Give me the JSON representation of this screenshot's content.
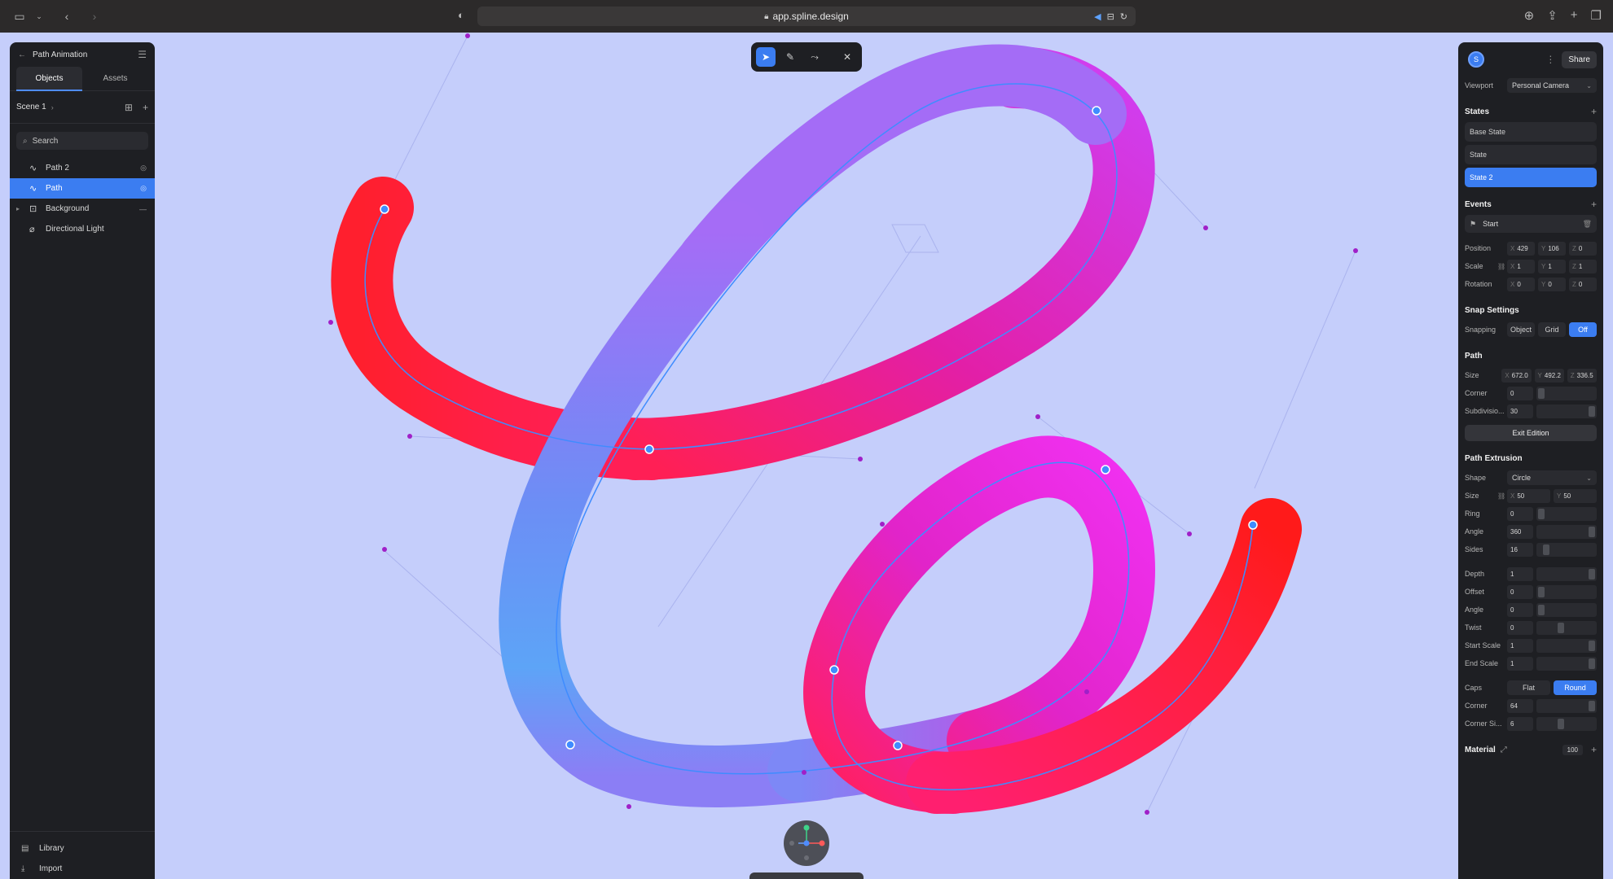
{
  "browser": {
    "url": "app.spline.design"
  },
  "left_panel": {
    "project_title": "Path Animation",
    "tabs": [
      "Objects",
      "Assets"
    ],
    "scene_label": "Scene 1",
    "search_placeholder": "Search",
    "objects": [
      {
        "name": "Path 2",
        "icon": "path-icon",
        "selected": false
      },
      {
        "name": "Path",
        "icon": "path-icon",
        "selected": true
      },
      {
        "name": "Background",
        "icon": "background-icon",
        "selected": false
      },
      {
        "name": "Directional Light",
        "icon": "light-icon",
        "selected": false
      }
    ],
    "footer": [
      "Library",
      "Import"
    ]
  },
  "toolbar": {
    "tools": [
      "select-tool",
      "pen-tool",
      "curve-tool",
      "close"
    ]
  },
  "right_panel": {
    "avatar_letter": "S",
    "share_label": "Share",
    "viewport_label": "Viewport",
    "viewport_value": "Personal Camera",
    "states_title": "States",
    "states": [
      "Base State",
      "State",
      "State 2"
    ],
    "active_state": "State 2",
    "events_title": "Events",
    "event": "Start",
    "position_label": "Position",
    "position": {
      "x": "429",
      "y": "106",
      "z": "0"
    },
    "scale_label": "Scale",
    "scale": {
      "x": "1",
      "y": "1",
      "z": "1"
    },
    "rotation_label": "Rotation",
    "rotation": {
      "x": "0",
      "y": "0",
      "z": "0"
    },
    "snap_title": "Snap Settings",
    "snapping_label": "Snapping",
    "snap_options": [
      "Object",
      "Grid",
      "Off"
    ],
    "snap_active": "Off",
    "path_title": "Path",
    "path_size_label": "Size",
    "path_size": {
      "x": "672.0",
      "y": "492.2",
      "z": "336.5"
    },
    "corner_label": "Corner",
    "corner_value": "0",
    "subdivision_label": "Subdivisio...",
    "subdivision_value": "30",
    "exit_edition_label": "Exit Edition",
    "extrusion_title": "Path Extrusion",
    "shape_label": "Shape",
    "shape_value": "Circle",
    "ext_size_label": "Size",
    "ext_size": {
      "x": "50",
      "y": "50"
    },
    "ring_label": "Ring",
    "ring_value": "0",
    "angle_label": "Angle",
    "angle_value": "360",
    "sides_label": "Sides",
    "sides_value": "16",
    "depth_label": "Depth",
    "depth_value": "1",
    "offset_label": "Offset",
    "offset_value": "0",
    "angle2_label": "Angle",
    "angle2_value": "0",
    "twist_label": "Twist",
    "twist_value": "0",
    "start_scale_label": "Start Scale",
    "start_scale_value": "1",
    "end_scale_label": "End Scale",
    "end_scale_value": "1",
    "caps_label": "Caps",
    "caps_options": [
      "Flat",
      "Round"
    ],
    "caps_active": "Round",
    "cap_corner_label": "Corner",
    "cap_corner_value": "64",
    "corner_si_label": "Corner Si...",
    "corner_si_value": "6",
    "material_title": "Material",
    "material_value": "100"
  },
  "colors": {
    "canvas": "#c5cefb",
    "accent": "#3b7df1",
    "panel": "#1e1f23",
    "tube_red": "#ff1a3c",
    "tube_blue": "#5b9bf5",
    "tube_magenta": "#e02ae0",
    "tube_violet": "#9b6cf5"
  }
}
